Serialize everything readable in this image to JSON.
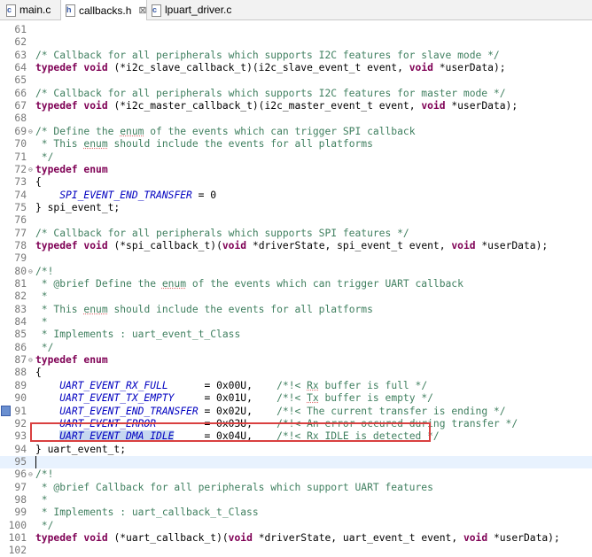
{
  "tabs": [
    {
      "label": "main.c",
      "icon": "c-file-icon",
      "active": false
    },
    {
      "label": "callbacks.h",
      "icon": "h-file-icon",
      "active": true,
      "close": "⊠"
    },
    {
      "label": "lpuart_driver.c",
      "icon": "c-file-icon",
      "active": false
    }
  ],
  "lines": [
    {
      "n": "61",
      "t": [
        {
          "s": ""
        }
      ]
    },
    {
      "n": "62",
      "t": [
        {
          "s": ""
        }
      ]
    },
    {
      "n": "63",
      "t": [
        {
          "s": "/* Callback for all peripherals which supports I2C features for slave mode */",
          "c": "cm"
        }
      ]
    },
    {
      "n": "64",
      "t": [
        {
          "s": "typedef",
          "c": "kw"
        },
        {
          "s": " "
        },
        {
          "s": "void",
          "c": "kw"
        },
        {
          "s": " (*i2c_slave_callback_t)(i2c_slave_event_t event, "
        },
        {
          "s": "void",
          "c": "kw"
        },
        {
          "s": " *userData);"
        }
      ]
    },
    {
      "n": "65",
      "t": [
        {
          "s": ""
        }
      ]
    },
    {
      "n": "66",
      "t": [
        {
          "s": "/* Callback for all peripherals which supports I2C features for master mode */",
          "c": "cm"
        }
      ]
    },
    {
      "n": "67",
      "t": [
        {
          "s": "typedef",
          "c": "kw"
        },
        {
          "s": " "
        },
        {
          "s": "void",
          "c": "kw"
        },
        {
          "s": " (*i2c_master_callback_t)(i2c_master_event_t event, "
        },
        {
          "s": "void",
          "c": "kw"
        },
        {
          "s": " *userData);"
        }
      ]
    },
    {
      "n": "68",
      "t": [
        {
          "s": ""
        }
      ]
    },
    {
      "n": "69",
      "fold": "⊖",
      "t": [
        {
          "s": "/* Define the ",
          "c": "cm"
        },
        {
          "s": "enum",
          "c": "cm sp"
        },
        {
          "s": " of the events which can trigger SPI callback",
          "c": "cm"
        }
      ]
    },
    {
      "n": "70",
      "t": [
        {
          "s": " * This ",
          "c": "cm"
        },
        {
          "s": "enum",
          "c": "cm sp"
        },
        {
          "s": " should include the events for all platforms",
          "c": "cm"
        }
      ]
    },
    {
      "n": "71",
      "t": [
        {
          "s": " */",
          "c": "cm"
        }
      ]
    },
    {
      "n": "72",
      "fold": "⊖",
      "t": [
        {
          "s": "typedef",
          "c": "kw"
        },
        {
          "s": " "
        },
        {
          "s": "enum",
          "c": "kw"
        }
      ]
    },
    {
      "n": "73",
      "t": [
        {
          "s": "{"
        }
      ]
    },
    {
      "n": "74",
      "t": [
        {
          "s": "    "
        },
        {
          "s": "SPI_EVENT_END_TRANSFER",
          "c": "mac"
        },
        {
          "s": " = 0"
        }
      ]
    },
    {
      "n": "75",
      "t": [
        {
          "s": "} spi_event_t;"
        }
      ]
    },
    {
      "n": "76",
      "t": [
        {
          "s": ""
        }
      ]
    },
    {
      "n": "77",
      "t": [
        {
          "s": "/* Callback for all peripherals which supports SPI features */",
          "c": "cm"
        }
      ]
    },
    {
      "n": "78",
      "t": [
        {
          "s": "typedef",
          "c": "kw"
        },
        {
          "s": " "
        },
        {
          "s": "void",
          "c": "kw"
        },
        {
          "s": " (*spi_callback_t)("
        },
        {
          "s": "void",
          "c": "kw"
        },
        {
          "s": " *driverState, spi_event_t event, "
        },
        {
          "s": "void",
          "c": "kw"
        },
        {
          "s": " *userData);"
        }
      ]
    },
    {
      "n": "79",
      "t": [
        {
          "s": ""
        }
      ]
    },
    {
      "n": "80",
      "fold": "⊖",
      "t": [
        {
          "s": "/*!",
          "c": "cm"
        }
      ]
    },
    {
      "n": "81",
      "t": [
        {
          "s": " * @brief Define the ",
          "c": "cm"
        },
        {
          "s": "enum",
          "c": "cm sp"
        },
        {
          "s": " of the events which can trigger UART callback",
          "c": "cm"
        }
      ]
    },
    {
      "n": "82",
      "t": [
        {
          "s": " *",
          "c": "cm"
        }
      ]
    },
    {
      "n": "83",
      "t": [
        {
          "s": " * This ",
          "c": "cm"
        },
        {
          "s": "enum",
          "c": "cm sp"
        },
        {
          "s": " should include the events for all platforms",
          "c": "cm"
        }
      ]
    },
    {
      "n": "84",
      "t": [
        {
          "s": " *",
          "c": "cm"
        }
      ]
    },
    {
      "n": "85",
      "t": [
        {
          "s": " * Implements : uart_event_t_Class",
          "c": "cm"
        }
      ]
    },
    {
      "n": "86",
      "t": [
        {
          "s": " */",
          "c": "cm"
        }
      ]
    },
    {
      "n": "87",
      "fold": "⊖",
      "t": [
        {
          "s": "typedef",
          "c": "kw"
        },
        {
          "s": " "
        },
        {
          "s": "enum",
          "c": "kw"
        }
      ]
    },
    {
      "n": "88",
      "t": [
        {
          "s": "{"
        }
      ]
    },
    {
      "n": "89",
      "t": [
        {
          "s": "    "
        },
        {
          "s": "UART_EVENT_RX_FULL",
          "c": "mac"
        },
        {
          "s": "      = 0x00U,    "
        },
        {
          "s": "/*!< ",
          "c": "cm"
        },
        {
          "s": "Rx",
          "c": "cm sp"
        },
        {
          "s": " buffer is full */",
          "c": "cm"
        }
      ]
    },
    {
      "n": "90",
      "t": [
        {
          "s": "    "
        },
        {
          "s": "UART_EVENT_TX_EMPTY",
          "c": "mac"
        },
        {
          "s": "     = 0x01U,    "
        },
        {
          "s": "/*!< ",
          "c": "cm"
        },
        {
          "s": "Tx",
          "c": "cm sp"
        },
        {
          "s": " buffer is empty */",
          "c": "cm"
        }
      ]
    },
    {
      "n": "91",
      "t": [
        {
          "s": "    "
        },
        {
          "s": "UART_EVENT_END_TRANSFER",
          "c": "mac"
        },
        {
          "s": " = 0x02U,    "
        },
        {
          "s": "/*!< The current transfer is ending */",
          "c": "cm"
        }
      ]
    },
    {
      "n": "92",
      "t": [
        {
          "s": "    "
        },
        {
          "s": "UART_EVENT_ERROR",
          "c": "mac"
        },
        {
          "s": "        = 0x03U,    "
        },
        {
          "s": "/*!< An error occured during transfer */",
          "c": "cm"
        }
      ]
    },
    {
      "n": "93",
      "marker": true,
      "t": [
        {
          "s": "    "
        },
        {
          "s": "UART_EVENT_DMA_IDLE",
          "c": "mac sel"
        },
        {
          "s": "     = 0x04U,    "
        },
        {
          "s": "/*!< ",
          "c": "cm"
        },
        {
          "s": "Rx",
          "c": "cm sp"
        },
        {
          "s": " IDLE is detected */",
          "c": "cm"
        }
      ]
    },
    {
      "n": "94",
      "t": [
        {
          "s": "} uart_event_t;"
        }
      ]
    },
    {
      "n": "95",
      "current": true,
      "t": [
        {
          "s": ""
        }
      ]
    },
    {
      "n": "96",
      "fold": "⊖",
      "t": [
        {
          "s": "/*!",
          "c": "cm"
        }
      ]
    },
    {
      "n": "97",
      "t": [
        {
          "s": " * @brief Callback for all peripherals which support UART features",
          "c": "cm"
        }
      ]
    },
    {
      "n": "98",
      "t": [
        {
          "s": " *",
          "c": "cm"
        }
      ]
    },
    {
      "n": "99",
      "t": [
        {
          "s": " * Implements : uart_callback_t_Class",
          "c": "cm"
        }
      ]
    },
    {
      "n": "100",
      "t": [
        {
          "s": " */",
          "c": "cm"
        }
      ]
    },
    {
      "n": "101",
      "t": [
        {
          "s": "typedef",
          "c": "kw"
        },
        {
          "s": " "
        },
        {
          "s": "void",
          "c": "kw"
        },
        {
          "s": " (*uart_callback_t)("
        },
        {
          "s": "void",
          "c": "kw"
        },
        {
          "s": " *driverState, uart_event_t event, "
        },
        {
          "s": "void",
          "c": "kw"
        },
        {
          "s": " *userData);"
        }
      ]
    },
    {
      "n": "102",
      "t": [
        {
          "s": ""
        }
      ]
    }
  ]
}
